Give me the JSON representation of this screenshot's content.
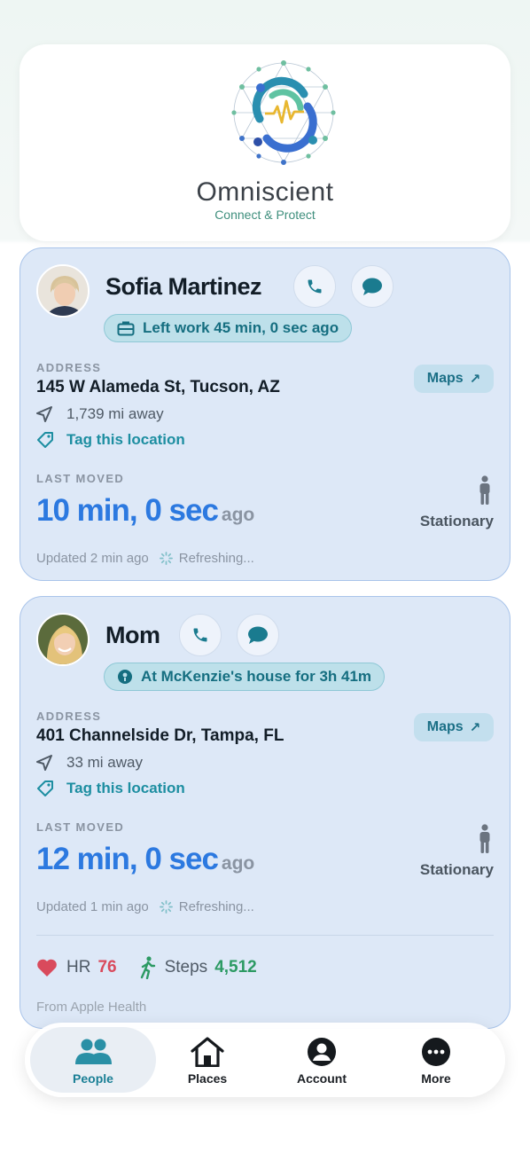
{
  "app": {
    "brand_name": "Omniscient",
    "tagline": "Connect & Protect"
  },
  "people": [
    {
      "name": "Sofia Martinez",
      "status": "Left work 45 min, 0 sec ago",
      "status_icon": "briefcase-icon",
      "address_label": "ADDRESS",
      "address": "145 W Alameda St, Tucson, AZ",
      "maps_label": "Maps",
      "distance": "1,739 mi away",
      "tag_label": "Tag this location",
      "last_moved_label": "LAST MOVED",
      "last_moved_value": "10 min, 0 sec",
      "last_moved_suffix": "ago",
      "motion_state": "Stationary",
      "updated": "Updated 2 min ago",
      "refreshing": "Refreshing..."
    },
    {
      "name": "Mom",
      "status": "At McKenzie's house for 3h 41m",
      "status_icon": "location-pin-icon",
      "address_label": "ADDRESS",
      "address": "401 Channelside Dr, Tampa, FL",
      "maps_label": "Maps",
      "distance": "33 mi away",
      "tag_label": "Tag this location",
      "last_moved_label": "LAST MOVED",
      "last_moved_value": "12 min, 0 sec",
      "last_moved_suffix": "ago",
      "motion_state": "Stationary",
      "updated": "Updated 1 min ago",
      "refreshing": "Refreshing...",
      "health": {
        "hr_label": "HR",
        "hr_value": "76",
        "steps_label": "Steps",
        "steps_value": "4,512",
        "source": "From Apple Health"
      }
    }
  ],
  "nav": {
    "items": [
      {
        "label": "People",
        "icon": "people-icon",
        "active": true
      },
      {
        "label": "Places",
        "icon": "house-icon",
        "active": false
      },
      {
        "label": "Account",
        "icon": "account-icon",
        "active": false
      },
      {
        "label": "More",
        "icon": "more-icon",
        "active": false
      }
    ]
  },
  "colors": {
    "accent_teal": "#1d8ea1",
    "accent_blue": "#2c79e0",
    "card_bg": "#dde8f7",
    "heart": "#d94a5c",
    "steps": "#2c9a63"
  }
}
